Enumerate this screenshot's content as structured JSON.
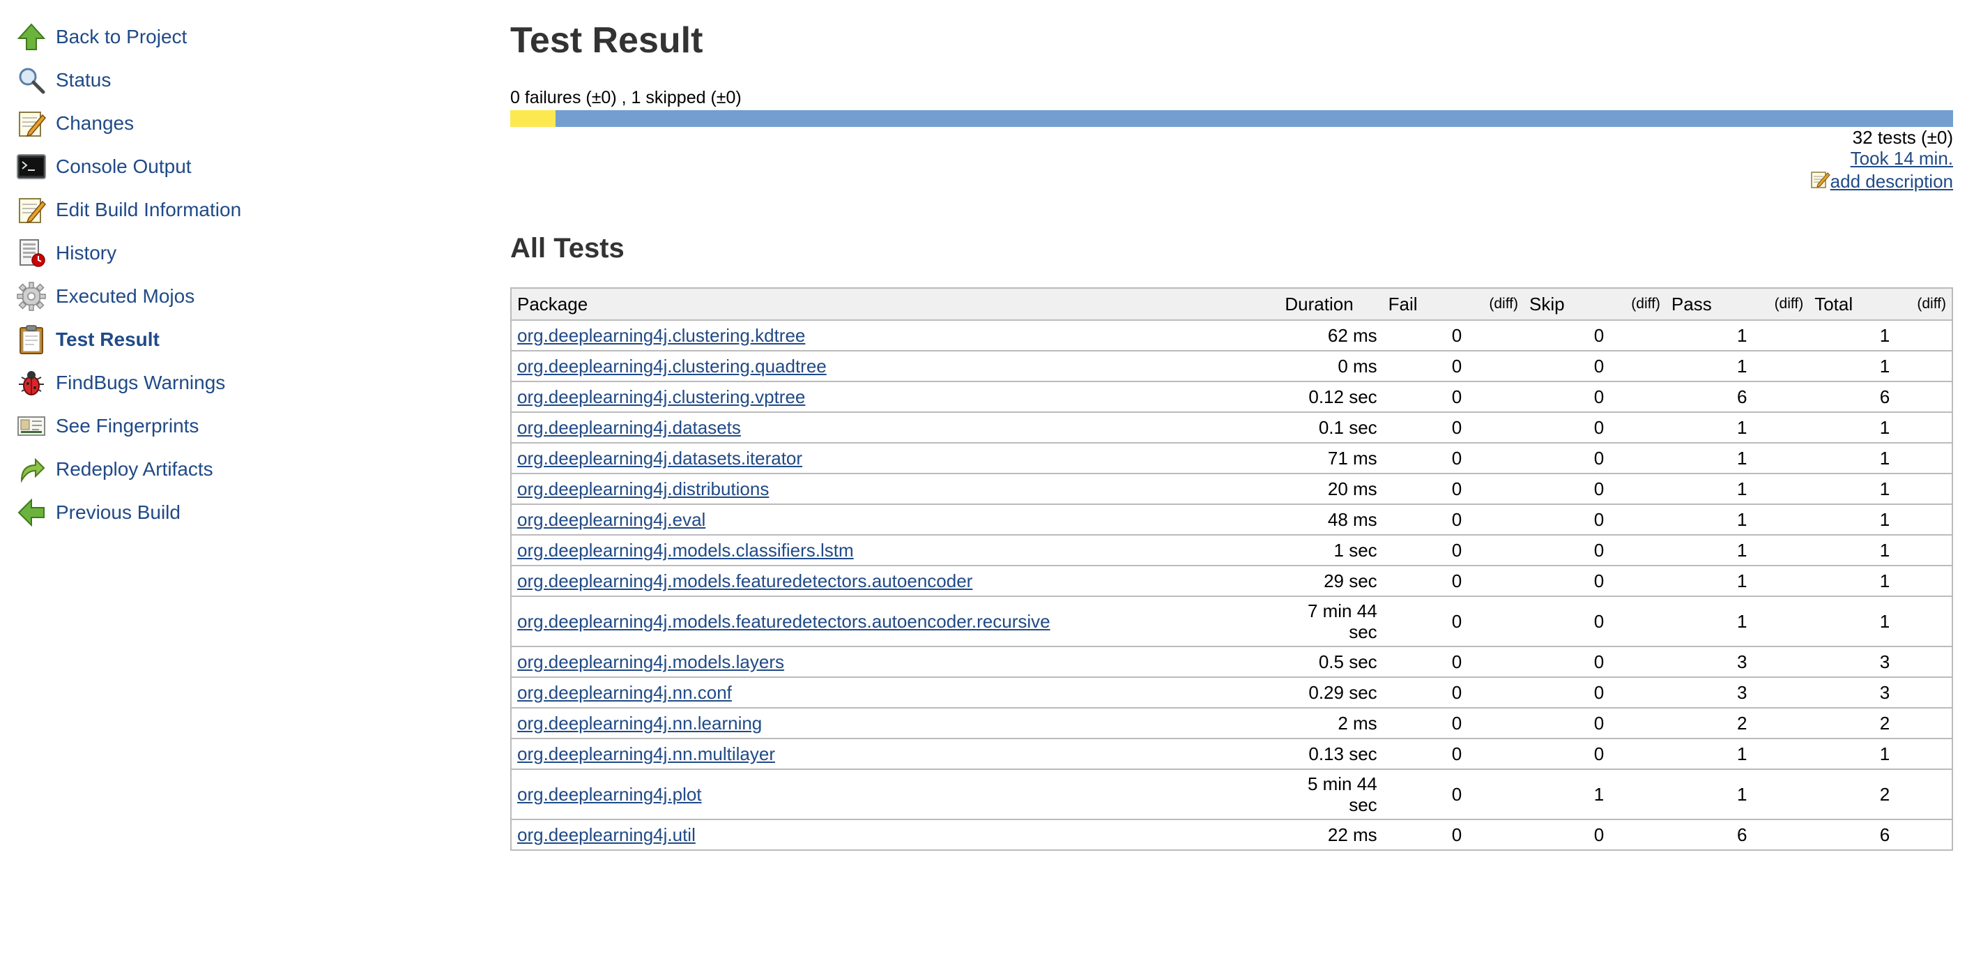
{
  "sidebar": {
    "items": [
      {
        "label": "Back to Project",
        "icon": "up-arrow-icon"
      },
      {
        "label": "Status",
        "icon": "magnifier-icon"
      },
      {
        "label": "Changes",
        "icon": "notepad-icon"
      },
      {
        "label": "Console Output",
        "icon": "terminal-icon"
      },
      {
        "label": "Edit Build Information",
        "icon": "notepad-icon"
      },
      {
        "label": "History",
        "icon": "history-icon"
      },
      {
        "label": "Executed Mojos",
        "icon": "gear-icon"
      },
      {
        "label": "Test Result",
        "icon": "clipboard-icon",
        "active": true
      },
      {
        "label": "FindBugs Warnings",
        "icon": "bug-icon"
      },
      {
        "label": "See Fingerprints",
        "icon": "fingerprint-card-icon"
      },
      {
        "label": "Redeploy Artifacts",
        "icon": "redeploy-arrow-icon"
      },
      {
        "label": "Previous Build",
        "icon": "left-arrow-icon"
      }
    ]
  },
  "main": {
    "title": "Test Result",
    "summary": "0 failures (±0) , 1 skipped (±0)",
    "progress": {
      "failed": 0,
      "skipped": 1,
      "total": 32
    },
    "tests_count": "32 tests (±0)",
    "took_link": "Took 14 min.",
    "add_description_link": "add description",
    "section_title": "All Tests"
  },
  "table": {
    "headers": {
      "package": "Package",
      "duration": "Duration",
      "fail": "Fail",
      "fail_diff": "(diff)",
      "skip": "Skip",
      "skip_diff": "(diff)",
      "pass": "Pass",
      "pass_diff": "(diff)",
      "total": "Total",
      "total_diff": "(diff)"
    },
    "rows": [
      {
        "package": "org.deeplearning4j.clustering.kdtree",
        "duration": "62 ms",
        "fail": "0",
        "skip": "0",
        "pass": "1",
        "total": "1"
      },
      {
        "package": "org.deeplearning4j.clustering.quadtree",
        "duration": "0 ms",
        "fail": "0",
        "skip": "0",
        "pass": "1",
        "total": "1"
      },
      {
        "package": "org.deeplearning4j.clustering.vptree",
        "duration": "0.12 sec",
        "fail": "0",
        "skip": "0",
        "pass": "6",
        "total": "6"
      },
      {
        "package": "org.deeplearning4j.datasets",
        "duration": "0.1 sec",
        "fail": "0",
        "skip": "0",
        "pass": "1",
        "total": "1"
      },
      {
        "package": "org.deeplearning4j.datasets.iterator",
        "duration": "71 ms",
        "fail": "0",
        "skip": "0",
        "pass": "1",
        "total": "1"
      },
      {
        "package": "org.deeplearning4j.distributions",
        "duration": "20 ms",
        "fail": "0",
        "skip": "0",
        "pass": "1",
        "total": "1"
      },
      {
        "package": "org.deeplearning4j.eval",
        "duration": "48 ms",
        "fail": "0",
        "skip": "0",
        "pass": "1",
        "total": "1"
      },
      {
        "package": "org.deeplearning4j.models.classifiers.lstm",
        "duration": "1 sec",
        "fail": "0",
        "skip": "0",
        "pass": "1",
        "total": "1"
      },
      {
        "package": "org.deeplearning4j.models.featuredetectors.autoencoder",
        "duration": "29 sec",
        "fail": "0",
        "skip": "0",
        "pass": "1",
        "total": "1"
      },
      {
        "package": "org.deeplearning4j.models.featuredetectors.autoencoder.recursive",
        "duration": "7 min 44 sec",
        "fail": "0",
        "skip": "0",
        "pass": "1",
        "total": "1"
      },
      {
        "package": "org.deeplearning4j.models.layers",
        "duration": "0.5 sec",
        "fail": "0",
        "skip": "0",
        "pass": "3",
        "total": "3"
      },
      {
        "package": "org.deeplearning4j.nn.conf",
        "duration": "0.29 sec",
        "fail": "0",
        "skip": "0",
        "pass": "3",
        "total": "3"
      },
      {
        "package": "org.deeplearning4j.nn.learning",
        "duration": "2 ms",
        "fail": "0",
        "skip": "0",
        "pass": "2",
        "total": "2"
      },
      {
        "package": "org.deeplearning4j.nn.multilayer",
        "duration": "0.13 sec",
        "fail": "0",
        "skip": "0",
        "pass": "1",
        "total": "1"
      },
      {
        "package": "org.deeplearning4j.plot",
        "duration": "5 min 44 sec",
        "fail": "0",
        "skip": "1",
        "pass": "1",
        "total": "2"
      },
      {
        "package": "org.deeplearning4j.util",
        "duration": "22 ms",
        "fail": "0",
        "skip": "0",
        "pass": "6",
        "total": "6"
      }
    ]
  },
  "colors": {
    "link": "#204a87",
    "bar_skip": "#fce94f",
    "bar_pass": "#729fcf",
    "bar_fail": "#ef2929",
    "table_header_bg": "#f0f0f0",
    "table_border": "#bbbbbb"
  }
}
